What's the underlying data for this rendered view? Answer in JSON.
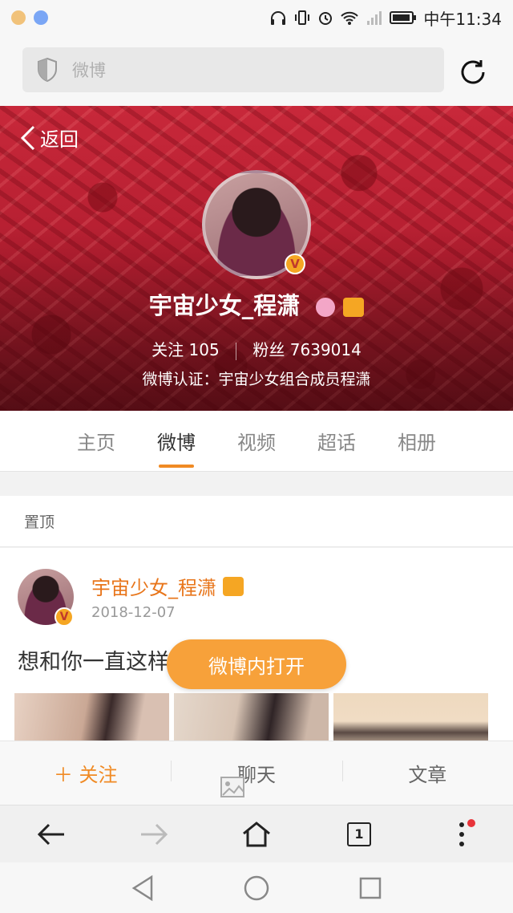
{
  "status_bar": {
    "time": "中午11:34"
  },
  "browser": {
    "search_placeholder": "微博"
  },
  "profile": {
    "back_label": "返回",
    "name": "宇宙少女_程潇",
    "following_label": "关注",
    "following_count": "105",
    "followers_label": "粉丝",
    "followers_count": "7639014",
    "verification": "微博认证：宇宙少女组合成员程潇",
    "badge": "V"
  },
  "tabs": [
    {
      "label": "主页",
      "active": false
    },
    {
      "label": "微博",
      "active": true
    },
    {
      "label": "视频",
      "active": false
    },
    {
      "label": "超话",
      "active": false
    },
    {
      "label": "相册",
      "active": false
    }
  ],
  "pinned_label": "置顶",
  "post": {
    "author": "宇宙少女_程潇",
    "date": "2018-12-07",
    "text": "想和你一直这样"
  },
  "open_in_app_label": "微博内打开",
  "actions": {
    "follow": "＋ 关注",
    "chat": "聊天",
    "articles": "文章"
  },
  "browser_nav": {
    "tab_count": "1"
  },
  "colors": {
    "accent": "#f08a24",
    "open_button": "#f7a13a",
    "cover": "#b31e30"
  }
}
